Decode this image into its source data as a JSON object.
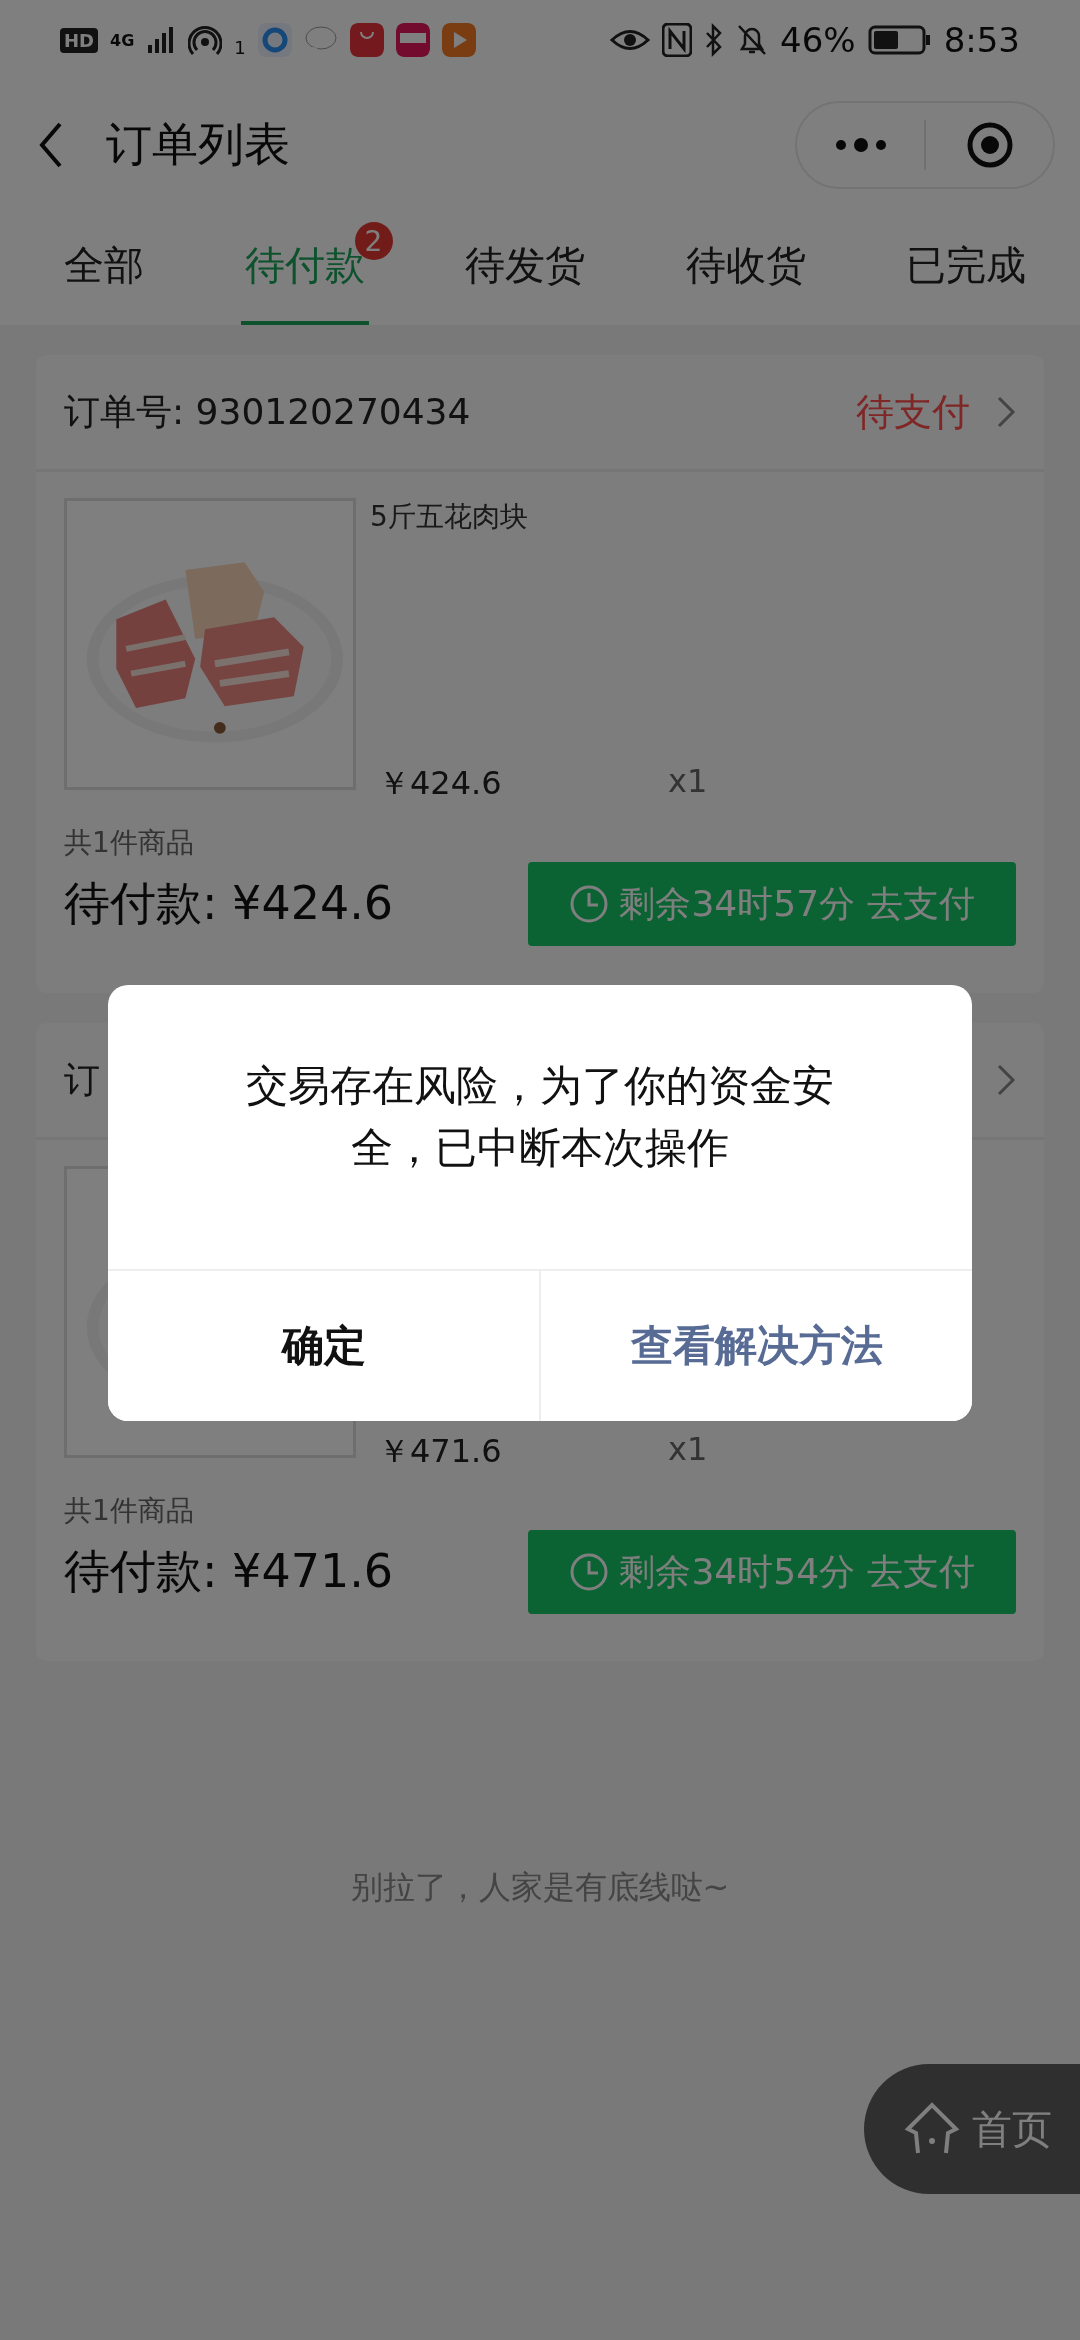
{
  "status_bar": {
    "network_badges": [
      "HD",
      "4G"
    ],
    "hotspot_count": "1",
    "battery": "46%",
    "time": "8:53"
  },
  "header": {
    "title": "订单列表"
  },
  "tabs": [
    {
      "label": "全部",
      "selected": false
    },
    {
      "label": "待付款",
      "selected": true,
      "badge": "2"
    },
    {
      "label": "待发货",
      "selected": false
    },
    {
      "label": "待收货",
      "selected": false
    },
    {
      "label": "已完成",
      "selected": false
    }
  ],
  "orders": [
    {
      "order_no": "订单号: 930120270434",
      "status": "待支付",
      "product": {
        "name": "5斤五花肉块",
        "price": "￥424.6",
        "quantity": "x1"
      },
      "count": "共1件商品",
      "total": "待付款: ¥424.6",
      "pay_button": "剩余34时57分 去支付"
    },
    {
      "order_no": "订",
      "product": {
        "price": "￥471.6",
        "quantity": "x1"
      },
      "count": "共1件商品",
      "total": "待付款: ¥471.6",
      "pay_button": "剩余34时54分 去支付"
    }
  ],
  "footer_note": "别拉了，人家是有底线哒~",
  "home_button": "首页",
  "dialog": {
    "message": "交易存在风险，为了你的资金安全，已中断本次操作",
    "buttons": [
      {
        "label": "确定",
        "kind": "plain"
      },
      {
        "label": "查看解决方法",
        "kind": "link"
      }
    ]
  }
}
